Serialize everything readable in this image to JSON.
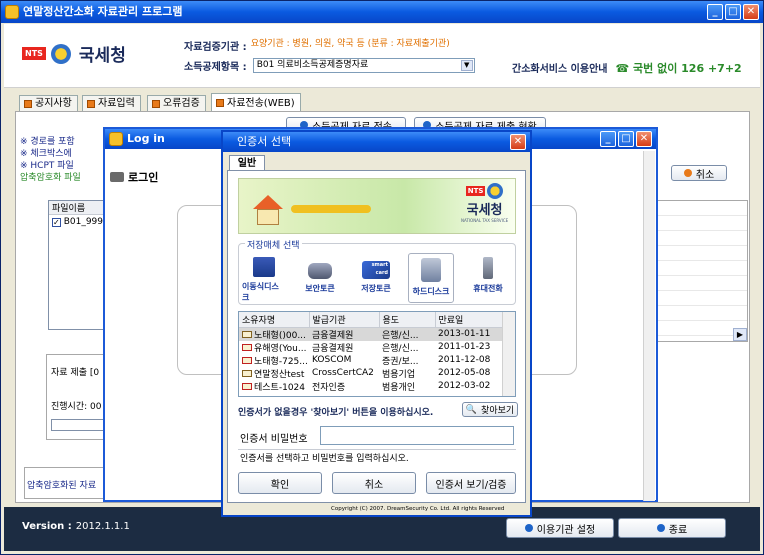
{
  "main_window": {
    "title": "연말정산간소화 자료관리 프로그램",
    "logo_badge": "NTS",
    "logo_text": "국세청",
    "info_row1_label": "자료검증기관 :",
    "info_row1_value": "요양기관 : 병원, 의원, 약국 등 (분류 : 자료제출기관)",
    "info_row2_label": "소득공제항목 :",
    "info_row2_value": "B01 의료비소득공제증명자료",
    "service_text": "간소화서비스 이용안내",
    "phone_text": "☎ 국번 없이 126 +7+2",
    "tabs": [
      "공지사항",
      "자료입력",
      "오류검증",
      "자료전송(WEB)"
    ],
    "btn_submit": "소득공제 자료 전송",
    "btn_status": "소득공제 자료 제출 현황",
    "cancel_btn": "취소",
    "notes": [
      "※ 경로를 포함",
      "※ 체크박스에",
      "※ HCPT 파일"
    ],
    "compressed_label": "압축암호화 파일",
    "file_header": "파일이름",
    "file_row": "B01_9998",
    "submit_label": "자료 제출 [0",
    "progress_label": "진행시간: 00",
    "footer_label": "압축암호화된 자료",
    "version_label": "Version :",
    "version_value": "2012.1.1.1",
    "btn_agency": "이용기관 설정",
    "btn_exit": "종료"
  },
  "login_window": {
    "title": "Log in",
    "label": "로그인"
  },
  "cert_dialog": {
    "title": "인증서 선택",
    "tab": "일반",
    "banner_badge": "NTS",
    "banner_text": "국세청",
    "banner_sub": "NATIONAL TAX SERVICE",
    "storage_label": "저장매체 선택",
    "media": [
      "이동식디스크",
      "보안토큰",
      "저장토큰",
      "하드디스크",
      "휴대전화"
    ],
    "smart_card_text": "smart card",
    "columns": [
      "소유자명",
      "발급기관",
      "용도",
      "만료일"
    ],
    "rows": [
      [
        "노태형()00...",
        "금융결제원",
        "은행/신...",
        "2013-01-11"
      ],
      [
        "유해영(You...",
        "금융결제원",
        "은행/신...",
        "2011-01-23"
      ],
      [
        "노태형-725...",
        "KOSCOM",
        "증권/보...",
        "2011-12-08"
      ],
      [
        "연말정산test",
        "CrossCertCA2",
        "범용기업",
        "2012-05-08"
      ],
      [
        "테스트-1024",
        "전자인증",
        "범용개인",
        "2012-03-02"
      ]
    ],
    "hint": "인증서가 없을경우 '찾아보기' 버튼을 이용하십시오.",
    "browse_btn": "찾아보기",
    "password_label": "인증서 비밀번호",
    "password_value": "",
    "status_msg": "인증서를 선택하고 비밀번호를 입력하십시오.",
    "btn_ok": "확인",
    "btn_cancel": "취소",
    "btn_view": "인증서 보기/검증",
    "copyright": "Copyright (C) 2007. DreamSecurity Co. Ltd. All rights Reserved"
  },
  "colors": {
    "titlebar": "#0a5ae0",
    "orange_text": "#e07000",
    "green_text": "#2a8a2a",
    "dark_footer": "#1c2c42"
  }
}
